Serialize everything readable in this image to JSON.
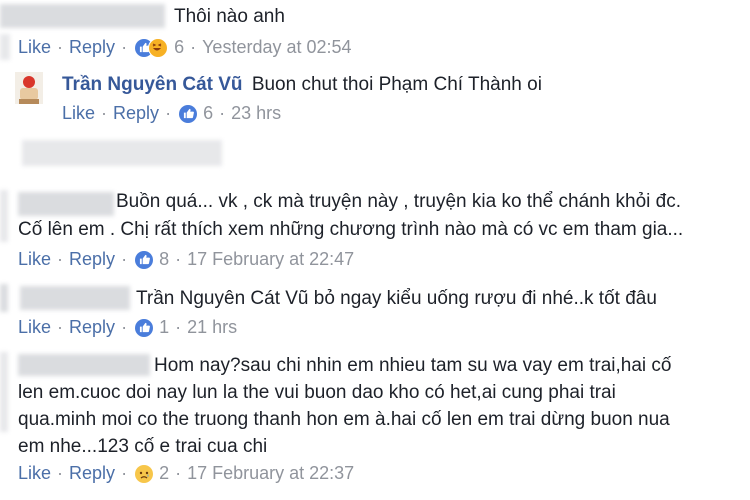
{
  "comments": [
    {
      "text": "Thôi nào anh",
      "actions": {
        "like": "Like",
        "reply": "Reply",
        "count": "6",
        "time": "Yesterday at 02:54"
      }
    },
    {
      "author": "Trần Nguyên Cát Vũ",
      "text": "Buon chut thoi Phạm Chí Thành oi",
      "actions": {
        "like": "Like",
        "reply": "Reply",
        "count": "6",
        "time": "23 hrs"
      }
    },
    {
      "lines": [
        "Buồn quá... vk , ck mà truyện này , truyện kia ko thể chánh khỏi đc.",
        "Cố lên em . Chị rất thích xem những chương trình nào mà có vc em tham gia..."
      ],
      "actions": {
        "like": "Like",
        "reply": "Reply",
        "count": "8",
        "time": "17 February at 22:47"
      }
    },
    {
      "text": "Trần Nguyên Cát Vũ bỏ ngay kiểu uống rượu đi nhé..k tốt đâu",
      "actions": {
        "like": "Like",
        "reply": "Reply",
        "count": "1",
        "time": "21 hrs"
      }
    },
    {
      "lines": [
        "Hom nay?sau chi nhin em nhieu tam su wa vay em trai,hai cố",
        "len em.cuoc doi nay lun la the vui buon dao kho có het,ai cung phai trai",
        "qua.minh moi co the truong thanh hon em à.hai cố len em trai dừng buon nua",
        "em nhe...123 cố e trai cua chi"
      ],
      "actions": {
        "like": "Like",
        "reply": "Reply",
        "count": "2",
        "time": "17 February at 22:37"
      }
    }
  ],
  "separator": "·",
  "colors": {
    "link": "#4b6fa8",
    "name": "#365899",
    "meta": "#90949c",
    "like_icon": "#4a7ddb"
  }
}
